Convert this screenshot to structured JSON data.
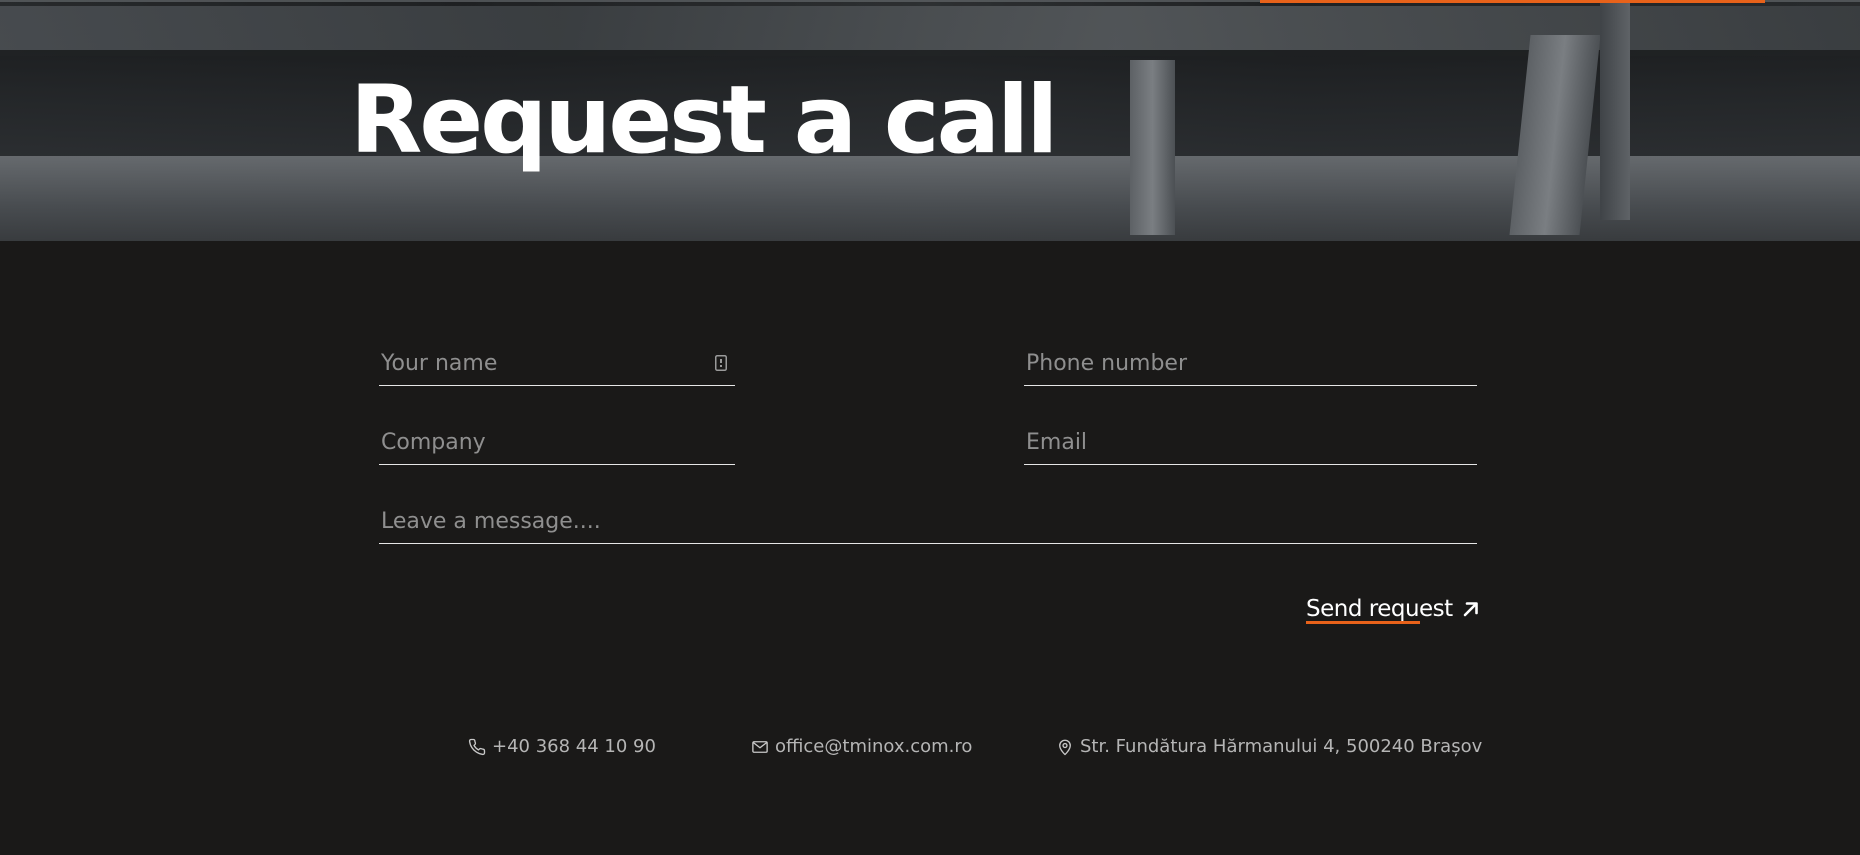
{
  "hero": {
    "title": "Request a call",
    "accent_color": "#e8621a"
  },
  "form": {
    "name_placeholder": "Your name",
    "phone_placeholder": "Phone number",
    "company_placeholder": "Company",
    "email_placeholder": "Email",
    "message_placeholder": "Leave a message....",
    "name_icon": "contact-card-icon"
  },
  "send": {
    "label": "Send request",
    "icon": "arrow-up-right-icon"
  },
  "contacts": {
    "phone": {
      "icon": "phone-icon",
      "text": "+40 368 44 10 90"
    },
    "email": {
      "icon": "mail-icon",
      "text": "office@tminox.com.ro"
    },
    "address": {
      "icon": "map-pin-icon",
      "text": "Str. Fundătura Hărmanului 4, 500240 Brașov"
    }
  }
}
